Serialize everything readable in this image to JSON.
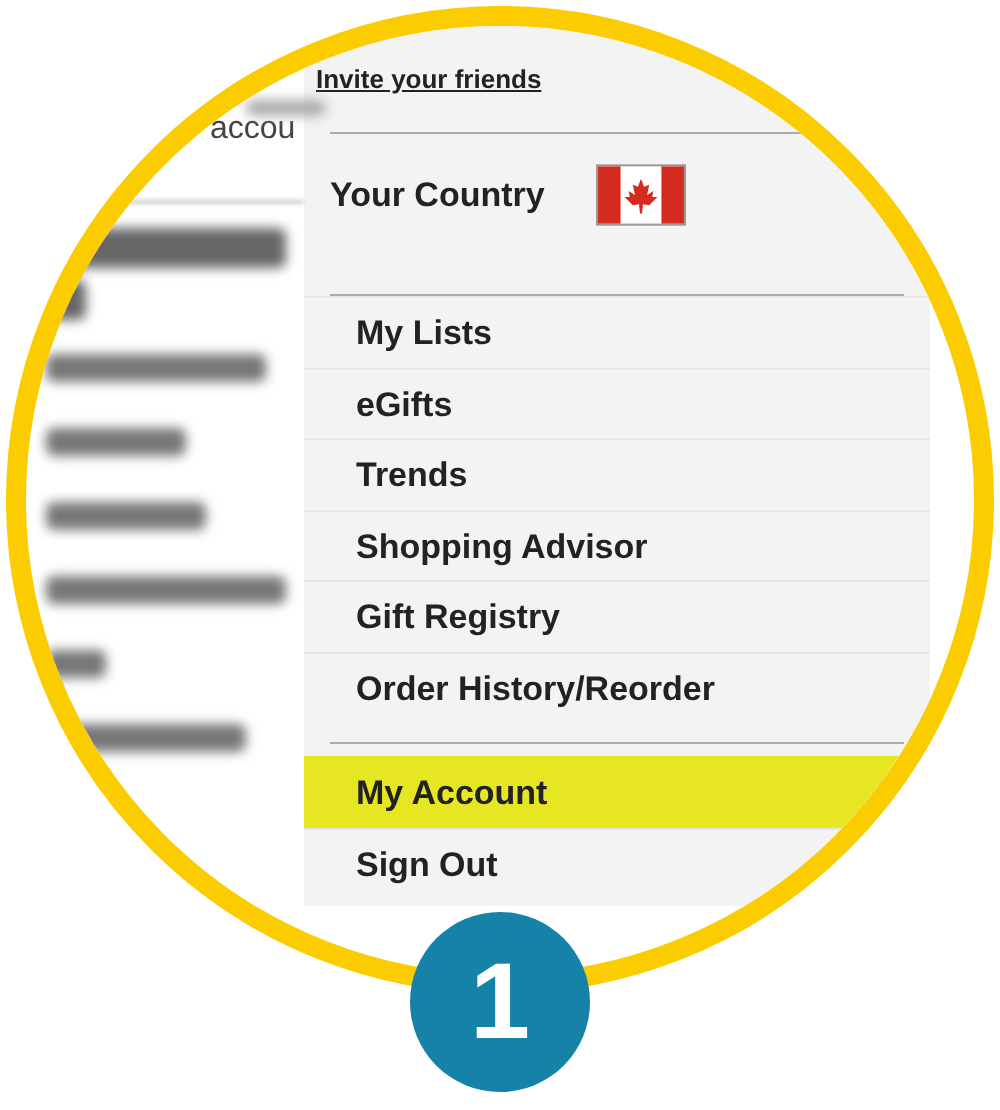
{
  "background_page": {
    "text": "accou"
  },
  "menu": {
    "invite_link": "Invite your friends",
    "country": {
      "label": "Your Country"
    },
    "items": [
      {
        "label": "My Lists",
        "selected": false
      },
      {
        "label": "eGifts",
        "selected": false
      },
      {
        "label": "Trends",
        "selected": false
      },
      {
        "label": "Shopping Advisor",
        "selected": false
      },
      {
        "label": "Gift Registry",
        "selected": false
      },
      {
        "label": "Order History/Reorder",
        "selected": false
      }
    ],
    "account_items": [
      {
        "label": "My Account",
        "selected": true
      },
      {
        "label": "Sign Out",
        "selected": false
      }
    ]
  },
  "step_badge": "1"
}
